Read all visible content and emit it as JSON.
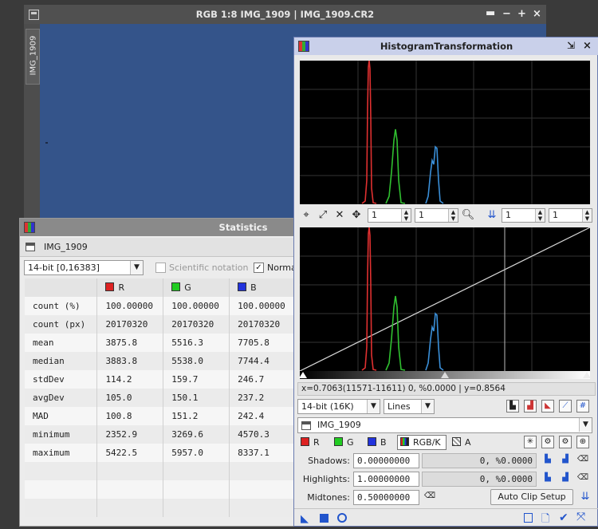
{
  "image_window": {
    "title": "RGB 1:8 IMG_1909 | IMG_1909.CR2",
    "side_tab": "IMG_1909",
    "controls": [
      "−",
      "+",
      "×"
    ]
  },
  "statistics": {
    "title": "Statistics",
    "view_name": "IMG_1909",
    "range_select": "14-bit [0,16383]",
    "scientific_label": "Scientific notation",
    "normalized_label": "Norma",
    "columns": [
      {
        "name": "R",
        "color": "#dd2222"
      },
      {
        "name": "G",
        "color": "#22cc22"
      },
      {
        "name": "B",
        "color": "#2233dd"
      }
    ],
    "rows": [
      {
        "label": "count (%)",
        "r": "100.00000",
        "g": "100.00000",
        "b": "100.00000"
      },
      {
        "label": "count (px)",
        "r": "20170320",
        "g": "20170320",
        "b": "20170320"
      },
      {
        "label": "mean",
        "r": "3875.8",
        "g": "5516.3",
        "b": "7705.8"
      },
      {
        "label": "median",
        "r": "3883.8",
        "g": "5538.0",
        "b": "7744.4"
      },
      {
        "label": "stdDev",
        "r": "114.2",
        "g": "159.7",
        "b": "246.7"
      },
      {
        "label": "avgDev",
        "r": "105.0",
        "g": "150.1",
        "b": "237.2"
      },
      {
        "label": "MAD",
        "r": "100.8",
        "g": "151.2",
        "b": "242.4"
      },
      {
        "label": "minimum",
        "r": "2352.9",
        "g": "3269.6",
        "b": "4570.3"
      },
      {
        "label": "maximum",
        "r": "5422.5",
        "g": "5957.0",
        "b": "8337.1"
      }
    ]
  },
  "histogram": {
    "title": "HistogramTransformation",
    "zoom_h1": "1",
    "zoom_v1": "1",
    "zoom_h2": "1",
    "zoom_v2": "1",
    "readout": "x=0.7063(11571-11611) 0, %0.0000 | y=0.8564",
    "depth_select": "14-bit (16K)",
    "style_select": "Lines",
    "view_select": "IMG_1909",
    "channels": {
      "r": "R",
      "g": "G",
      "b": "B",
      "rgbk": "RGB/K",
      "a": "A"
    },
    "shadows_label": "Shadows:",
    "shadows_value": "0.00000000",
    "shadows_clip": "0, %0.0000",
    "highlights_label": "Highlights:",
    "highlights_value": "1.00000000",
    "highlights_clip": "0, %0.0000",
    "midtones_label": "Midtones:",
    "midtones_value": "0.50000000",
    "auto_clip_label": "Auto Clip Setup"
  }
}
